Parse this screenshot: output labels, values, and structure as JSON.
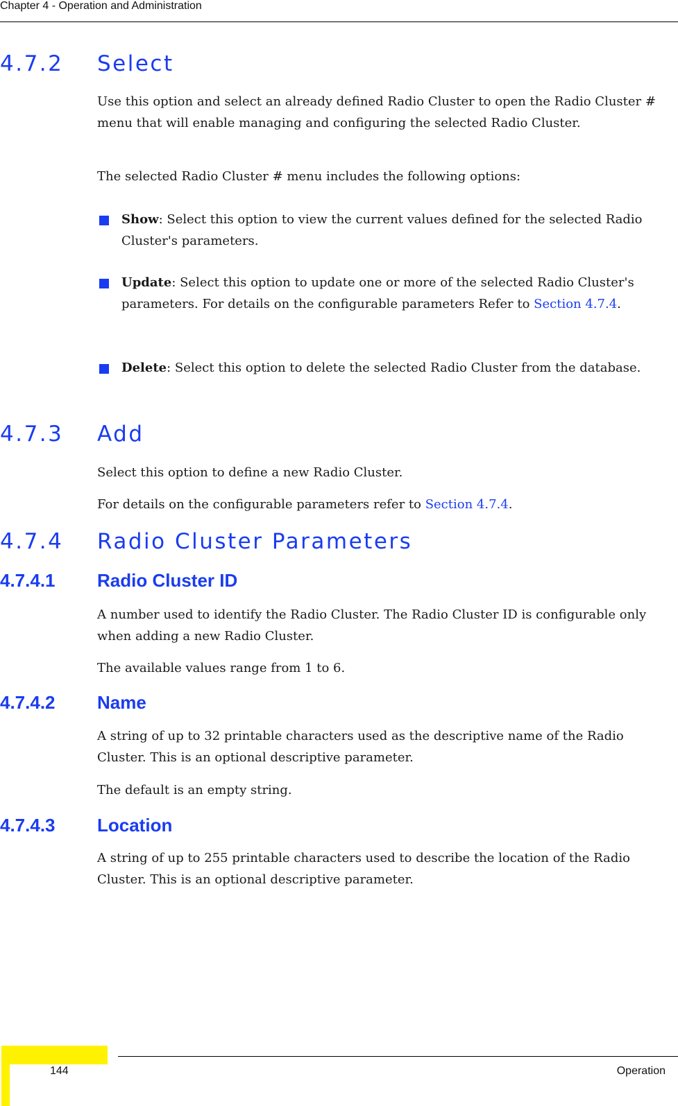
{
  "header": {
    "chapter": "Chapter 4 - Operation and Administration"
  },
  "sections": {
    "select": {
      "number": "4.7.2",
      "title": "Select",
      "para1": "Use this option and select an already defined Radio Cluster to open the Radio Cluster # menu that will enable managing and configuring the selected Radio Cluster.",
      "para2": "The selected Radio Cluster # menu includes the following options:",
      "bullets": [
        {
          "term": "Show",
          "text": ": Select this option to view the current values defined for the selected Radio Cluster's parameters."
        },
        {
          "term": "Update",
          "text": ": Select this option to update one or more of the selected Radio Cluster's parameters. For details on the configurable parameters Refer to ",
          "link": "Section 4.7.4",
          "after": "."
        },
        {
          "term": "Delete",
          "text": ": Select this option to delete the selected Radio Cluster from the database."
        }
      ]
    },
    "add": {
      "number": "4.7.3",
      "title": "Add",
      "para1": "Select this option to define a new Radio Cluster.",
      "para2_pre": "For details on the configurable parameters refer to ",
      "para2_link": "Section 4.7.4",
      "para2_post": "."
    },
    "params": {
      "number": "4.7.4",
      "title": "Radio Cluster Parameters",
      "sub": [
        {
          "number": "4.7.4.1",
          "title": "Radio Cluster ID",
          "para1": "A number used to identify the Radio Cluster. The Radio Cluster ID is configurable only when adding a new Radio Cluster.",
          "para2": "The available values range from 1 to 6."
        },
        {
          "number": "4.7.4.2",
          "title": "Name",
          "para1": "A string of up to 32 printable characters used as the descriptive name of the Radio Cluster. This is an optional descriptive parameter.",
          "para2": "The default is an empty string."
        },
        {
          "number": "4.7.4.3",
          "title": "Location",
          "para1": "A string of up to 255 printable characters used to describe the location of the Radio Cluster. This is an optional descriptive parameter."
        }
      ]
    }
  },
  "footer": {
    "page_number": "144",
    "section": "Operation"
  },
  "colors": {
    "heading_blue": "#1a3cf0",
    "footer_yellow": "#fff200"
  }
}
